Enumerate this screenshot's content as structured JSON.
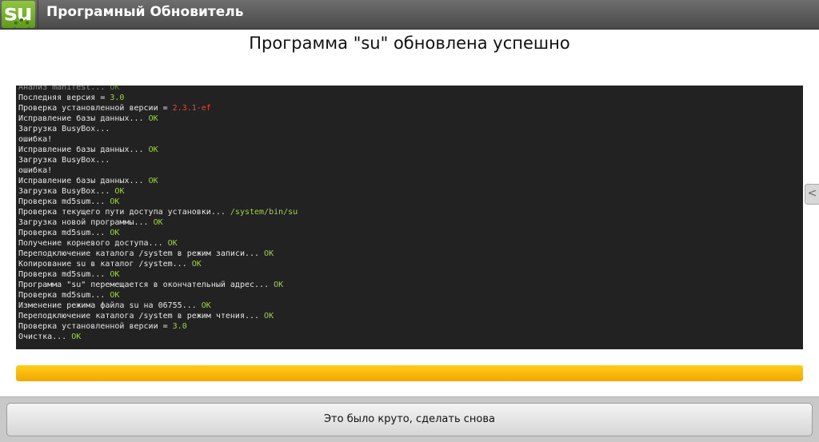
{
  "app": {
    "title": "Програмный Обновитель",
    "icon_text": "su"
  },
  "status": {
    "heading": "Программа \"su\" обновлена успешно"
  },
  "terminal": {
    "lines": [
      [
        {
          "t": "Анализ manifest... "
        },
        {
          "t": "OK",
          "c": "ok"
        }
      ],
      [
        {
          "t": "Последняя версия = "
        },
        {
          "t": "3.0",
          "c": "green"
        }
      ],
      [
        {
          "t": "Проверка установленной версии = "
        },
        {
          "t": "2.3.1-ef",
          "c": "red"
        }
      ],
      [
        {
          "t": "Исправление базы данных... "
        },
        {
          "t": "OK",
          "c": "ok"
        }
      ],
      [
        {
          "t": "Загрузка BusyBox..."
        }
      ],
      [
        {
          "t": "ошибка!"
        }
      ],
      [
        {
          "t": "Исправление базы данных... "
        },
        {
          "t": "OK",
          "c": "ok"
        }
      ],
      [
        {
          "t": "Загрузка BusyBox..."
        }
      ],
      [
        {
          "t": "ошибка!"
        }
      ],
      [
        {
          "t": "Исправление базы данных... "
        },
        {
          "t": "OK",
          "c": "ok"
        }
      ],
      [
        {
          "t": "Загрузка BusyBox... "
        },
        {
          "t": "OK",
          "c": "ok"
        }
      ],
      [
        {
          "t": "Проверка md5sum... "
        },
        {
          "t": "OK",
          "c": "ok"
        }
      ],
      [
        {
          "t": "Проверка текущего пути доступа установки... "
        },
        {
          "t": "/system/bin/su",
          "c": "green"
        }
      ],
      [
        {
          "t": "Загрузка новой программы... "
        },
        {
          "t": "OK",
          "c": "ok"
        }
      ],
      [
        {
          "t": "Проверка md5sum... "
        },
        {
          "t": "OK",
          "c": "ok"
        }
      ],
      [
        {
          "t": "Получение корневого доступа... "
        },
        {
          "t": "OK",
          "c": "ok"
        }
      ],
      [
        {
          "t": "Переподключение каталога /system в режим записи... "
        },
        {
          "t": "OK",
          "c": "ok"
        }
      ],
      [
        {
          "t": "Копирование su в каталог /system... "
        },
        {
          "t": "OK",
          "c": "ok"
        }
      ],
      [
        {
          "t": "Проверка md5sum... "
        },
        {
          "t": "OK",
          "c": "ok"
        }
      ],
      [
        {
          "t": "Программа \"su\" перемещается в окончательный адрес... "
        },
        {
          "t": "OK",
          "c": "ok"
        }
      ],
      [
        {
          "t": "Проверка md5sum... "
        },
        {
          "t": "OK",
          "c": "ok"
        }
      ],
      [
        {
          "t": "Изменение режима файла su на 06755... "
        },
        {
          "t": "OK",
          "c": "ok"
        }
      ],
      [
        {
          "t": "Переподключение каталога /system в режим чтения... "
        },
        {
          "t": "OK",
          "c": "ok"
        }
      ],
      [
        {
          "t": "Проверка установленной версии = "
        },
        {
          "t": "3.0",
          "c": "green"
        }
      ],
      [
        {
          "t": "Очистка... "
        },
        {
          "t": "OK",
          "c": "ok"
        }
      ]
    ]
  },
  "progress": {
    "percent": 100
  },
  "action": {
    "button_label": "Это было круто, сделать снова"
  },
  "side_handle": {
    "glyph": "<"
  },
  "colors": {
    "accent": "#f5b800",
    "ok_text": "#9fd14a",
    "error_text": "#e04a3a",
    "terminal_bg": "#222222"
  }
}
